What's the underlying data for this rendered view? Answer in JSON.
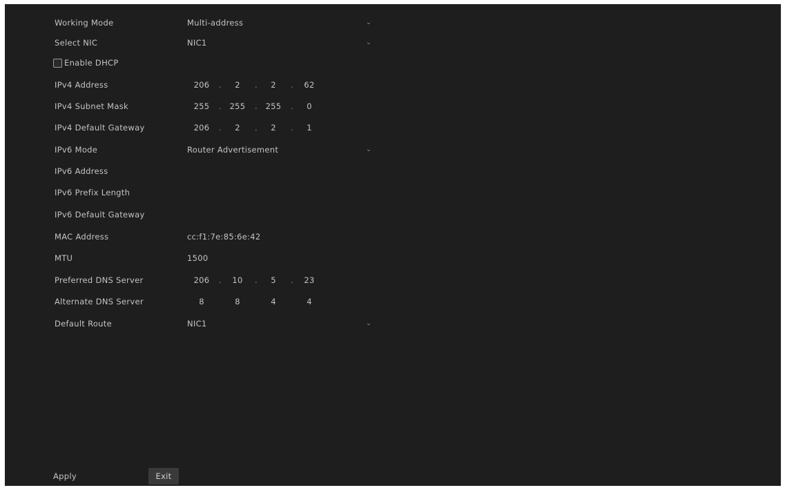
{
  "working_mode": {
    "label": "Working Mode",
    "value": "Multi-address"
  },
  "select_nic": {
    "label": "Select NIC",
    "value": "NIC1"
  },
  "enable_dhcp": {
    "label": "Enable DHCP",
    "checked": false
  },
  "ipv4_address": {
    "label": "IPv4 Address",
    "octets": [
      "206",
      "2",
      "2",
      "62"
    ]
  },
  "ipv4_subnet_mask": {
    "label": "IPv4 Subnet Mask",
    "octets": [
      "255",
      "255",
      "255",
      "0"
    ]
  },
  "ipv4_default_gateway": {
    "label": "IPv4 Default Gateway",
    "octets": [
      "206",
      "2",
      "2",
      "1"
    ]
  },
  "ipv6_mode": {
    "label": "IPv6 Mode",
    "value": "Router Advertisement"
  },
  "ipv6_address": {
    "label": "IPv6 Address",
    "value": ""
  },
  "ipv6_prefix_length": {
    "label": "IPv6 Prefix Length",
    "value": ""
  },
  "ipv6_default_gateway": {
    "label": "IPv6 Default Gateway",
    "value": ""
  },
  "mac_address": {
    "label": "MAC Address",
    "value": "cc:f1:7e:85:6e:42"
  },
  "mtu": {
    "label": "MTU",
    "value": "1500"
  },
  "preferred_dns": {
    "label": "Preferred DNS Server",
    "octets": [
      "206",
      "10",
      "5",
      "23"
    ]
  },
  "alternate_dns": {
    "label": "Alternate DNS Server",
    "octets": [
      "8",
      "8",
      "4",
      "4"
    ]
  },
  "default_route": {
    "label": "Default Route",
    "value": "NIC1"
  },
  "footer": {
    "apply_label": "Apply",
    "exit_label": "Exit"
  },
  "icons": {
    "dropdown": "chevron-down-icon",
    "checkbox": "checkbox-unchecked-icon"
  },
  "colors": {
    "background": "#1e1e1e",
    "text": "#c4c4c4",
    "button": "#3a3a3a"
  }
}
